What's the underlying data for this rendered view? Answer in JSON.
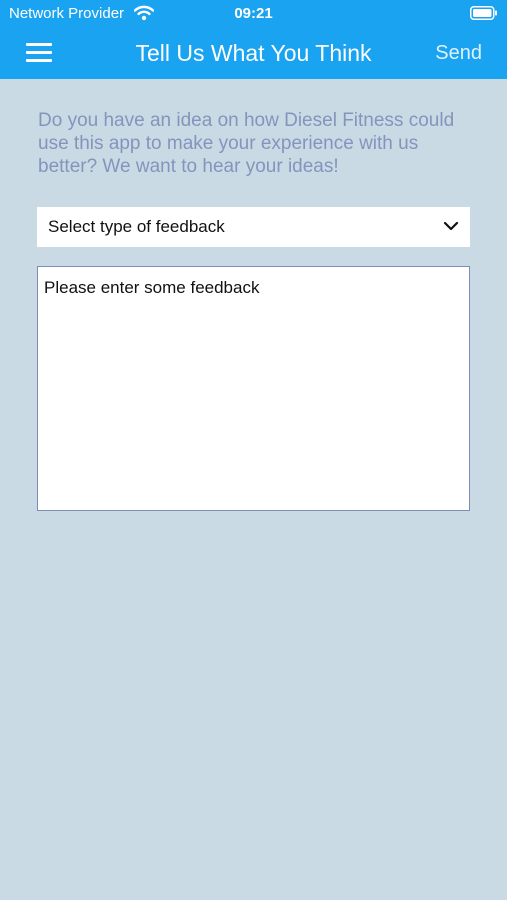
{
  "status_bar": {
    "provider": "Network Provider",
    "time": "09:21",
    "wifi_icon": "wifi-icon",
    "battery_icon": "battery-icon"
  },
  "header": {
    "menu_icon": "hamburger-menu-icon",
    "title": "Tell Us What You Think",
    "send_label": "Send",
    "background_color": "#1aa3f0"
  },
  "form": {
    "intro_text": "Do you have an idea on how Diesel Fitness could use this app to make your experience with us better? We want to hear your ideas!",
    "feedback_type": {
      "selected": "Select type of feedback",
      "icon": "chevron-down-icon"
    },
    "feedback_text": {
      "placeholder": "Please enter some feedback",
      "value": ""
    }
  },
  "colors": {
    "page_background": "#c9dae4",
    "intro_text": "#8494bd",
    "textarea_border": "#7f8cb5"
  }
}
